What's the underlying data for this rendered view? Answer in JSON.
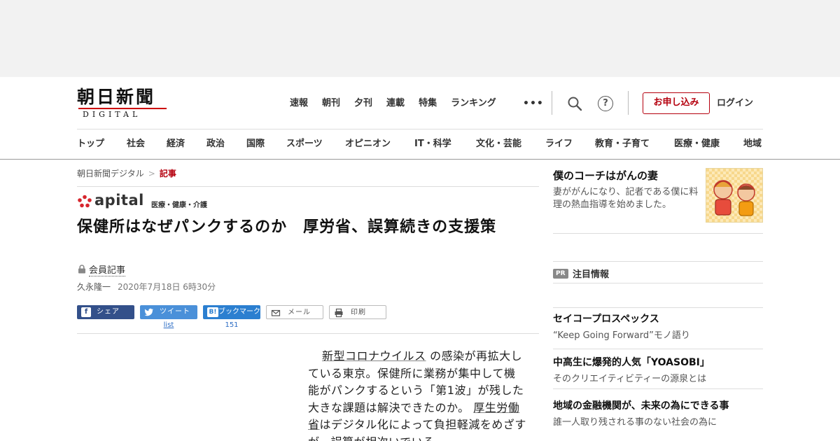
{
  "header": {
    "logo_main": "朝日新聞",
    "logo_sub": "DIGITAL",
    "top_nav": [
      "速報",
      "朝刊",
      "夕刊",
      "連載",
      "特集",
      "ランキング"
    ],
    "more": "•••",
    "help": "?",
    "subscribe": "お申し込み",
    "login": "ログイン"
  },
  "categories": [
    "トップ",
    "社会",
    "経済",
    "政治",
    "国際",
    "スポーツ",
    "オピニオン",
    "IT・科学",
    "文化・芸能",
    "ライフ",
    "教育・子育て",
    "医療・健康",
    "地域"
  ],
  "breadcrumb": {
    "home": "朝日新聞デジタル",
    "sep": ">",
    "current": "記事"
  },
  "article": {
    "brand": "apital",
    "brand_sub": "医療・健康・介護",
    "headline": "保健所はなぜパンクするのか　厚労省、誤算続きの支援策",
    "member": "会員記事",
    "author": "久永隆一",
    "date": "2020年7月18日 6時30分",
    "share": {
      "facebook": "シェア",
      "twitter": "ツイート",
      "hatena": "ブックマーク",
      "hatena_glyph": "B!",
      "mail": "メール",
      "print": "印刷",
      "twitter_count": "list",
      "hatena_count": "151"
    },
    "body": {
      "link1": "新型コロナウイルス",
      "p1": "の感染が再拡大している東京。保健所に業務が集中して機能がパンクするという「第1波」が残した大きな課題は解決できたのか。",
      "link2": "厚生労働省",
      "p2": "はデジタル化によって負担軽減をめざすが、誤算が相次いでいる。"
    }
  },
  "sidebar": {
    "promo_title": "僕のコーチはがんの妻",
    "promo_desc": "妻ががんになり、記者である僕に料理の熱血指導を始めました。",
    "pr_badge": "PR",
    "pr_title": "注目情報",
    "ads": [
      {
        "title": "セイコープロスペックス",
        "desc": "“Keep Going Forward”モノ語り"
      },
      {
        "title": "中高生に爆発的人気「YOASOBI」",
        "desc": "そのクリエイティビティーの源泉とは"
      },
      {
        "title": "地域の金融機関が、未来の為にできる事",
        "desc": "誰一人取り残される事のない社会の為に"
      }
    ]
  },
  "colors": {
    "accent_red": "#b5000e",
    "facebook": "#33508a",
    "twitter": "#4a90d9",
    "hatena": "#2b7fd0"
  }
}
